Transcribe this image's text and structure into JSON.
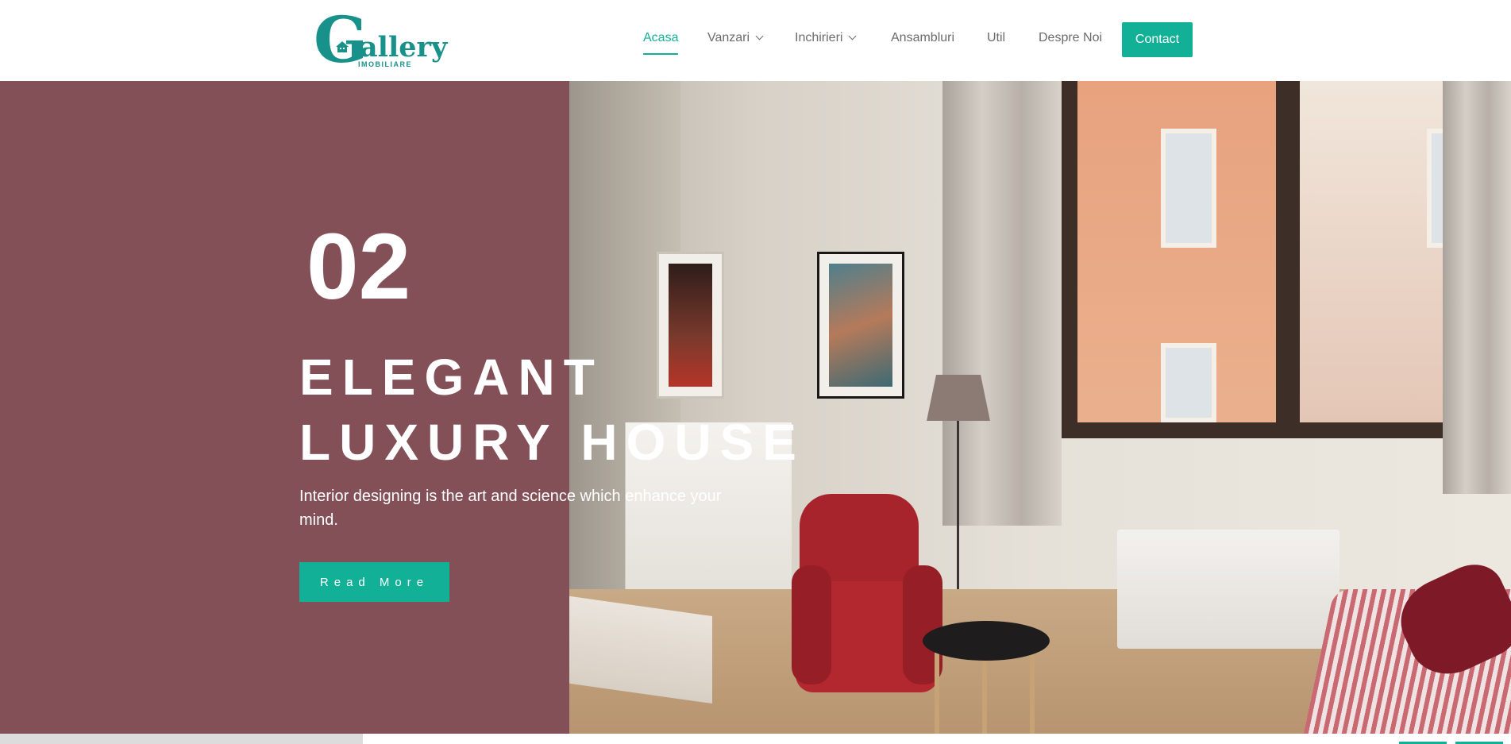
{
  "header": {
    "logo_letter": "G",
    "logo_word": "allery",
    "logo_sub": "IMOBILIARE",
    "nav": [
      {
        "label": "Acasa",
        "active": true,
        "dropdown": false
      },
      {
        "label": "Vanzari",
        "active": false,
        "dropdown": true
      },
      {
        "label": "Inchirieri",
        "active": false,
        "dropdown": true
      },
      {
        "label": "Ansambluri",
        "active": false,
        "dropdown": false
      },
      {
        "label": "Util",
        "active": false,
        "dropdown": false
      },
      {
        "label": "Despre Noi",
        "active": false,
        "dropdown": false
      }
    ],
    "contact_label": "Contact"
  },
  "hero": {
    "slide_number": "02",
    "title_line1": "ELEGANT",
    "title_line2": "LUXURY HOUSE",
    "description": "Interior designing is the art and science which enhance your mind.",
    "cta_label": "Read More"
  },
  "colors": {
    "accent": "#12b096",
    "hero_panel": "#845058",
    "logo": "#18918a"
  },
  "icons": [
    "house-icon",
    "chevron-down-icon"
  ]
}
